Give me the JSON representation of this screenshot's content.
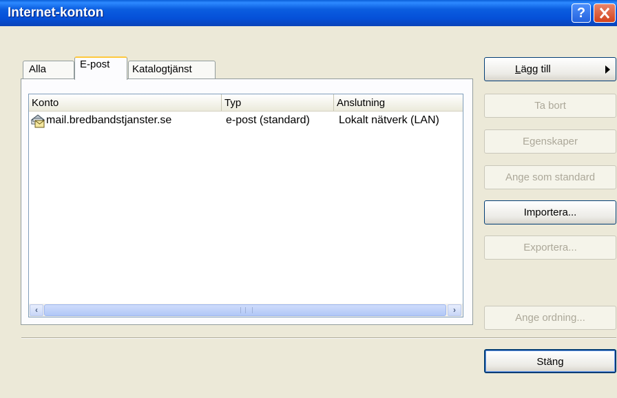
{
  "window": {
    "title": "Internet-konton",
    "help_glyph": "?",
    "close_glyph": "✕"
  },
  "tabs": [
    {
      "label": "Alla",
      "selected": false
    },
    {
      "label": "E-post",
      "selected": true
    },
    {
      "label": "Katalogtjänst",
      "selected": false
    }
  ],
  "list": {
    "columns": [
      "Konto",
      "Typ",
      "Anslutning"
    ],
    "rows": [
      {
        "konto": "mail.bredbandstjanster.se",
        "typ": "e-post (standard)",
        "anslutning": "Lokalt nätverk (LAN)",
        "icon": "mail-account-icon"
      }
    ],
    "scroll_left": "‹",
    "scroll_right": "›"
  },
  "buttons": {
    "add_first": "L",
    "add_rest": "ägg till",
    "remove": "Ta bort",
    "properties": "Egenskaper",
    "set_default": "Ange som standard",
    "import": "Importera...",
    "export": "Exportera...",
    "set_order": "Ange ordning...",
    "close": "Stäng"
  },
  "colors": {
    "titlebar": "#0550d8",
    "face": "#ece9d8",
    "disabled_text": "#aca899"
  }
}
